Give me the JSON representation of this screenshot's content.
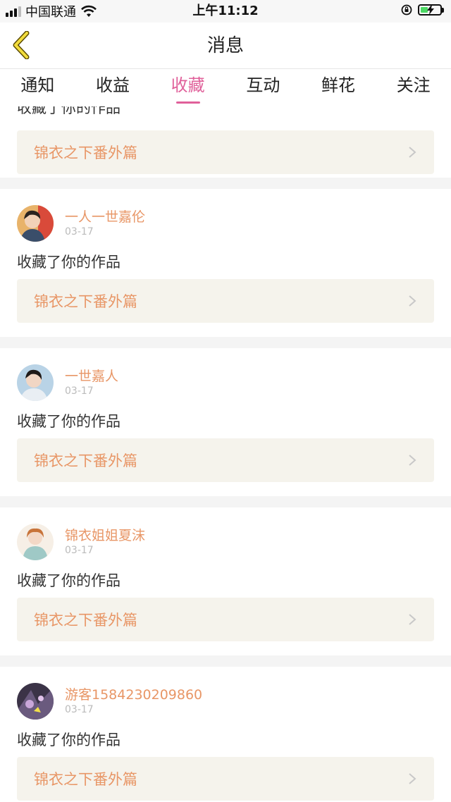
{
  "status_bar": {
    "carrier": "中国联通",
    "time": "上午11:12"
  },
  "nav": {
    "title": "消息",
    "back_icon": "back-chevron-icon"
  },
  "tabs": [
    {
      "label": "通知",
      "active": false
    },
    {
      "label": "收益",
      "active": false
    },
    {
      "label": "收藏",
      "active": true
    },
    {
      "label": "互动",
      "active": false
    },
    {
      "label": "鲜花",
      "active": false
    },
    {
      "label": "关注",
      "active": false
    }
  ],
  "first_partial": {
    "action": "收藏了你的作品",
    "work_title": "锦衣之下番外篇"
  },
  "notifications": [
    {
      "username": "一人一世嘉伦",
      "date": "03-17",
      "action": "收藏了你的作品",
      "work_title": "锦衣之下番外篇"
    },
    {
      "username": "一世嘉人",
      "date": "03-17",
      "action": "收藏了你的作品",
      "work_title": "锦衣之下番外篇"
    },
    {
      "username": "锦衣姐姐夏沫",
      "date": "03-17",
      "action": "收藏了你的作品",
      "work_title": "锦衣之下番外篇"
    },
    {
      "username": "游客1584230209860",
      "date": "03-17",
      "action": "收藏了你的作品",
      "work_title": "锦衣之下番外篇"
    }
  ],
  "colors": {
    "accent": "#e0609a",
    "username": "#e89666",
    "work_bg": "#f5f3ec"
  }
}
